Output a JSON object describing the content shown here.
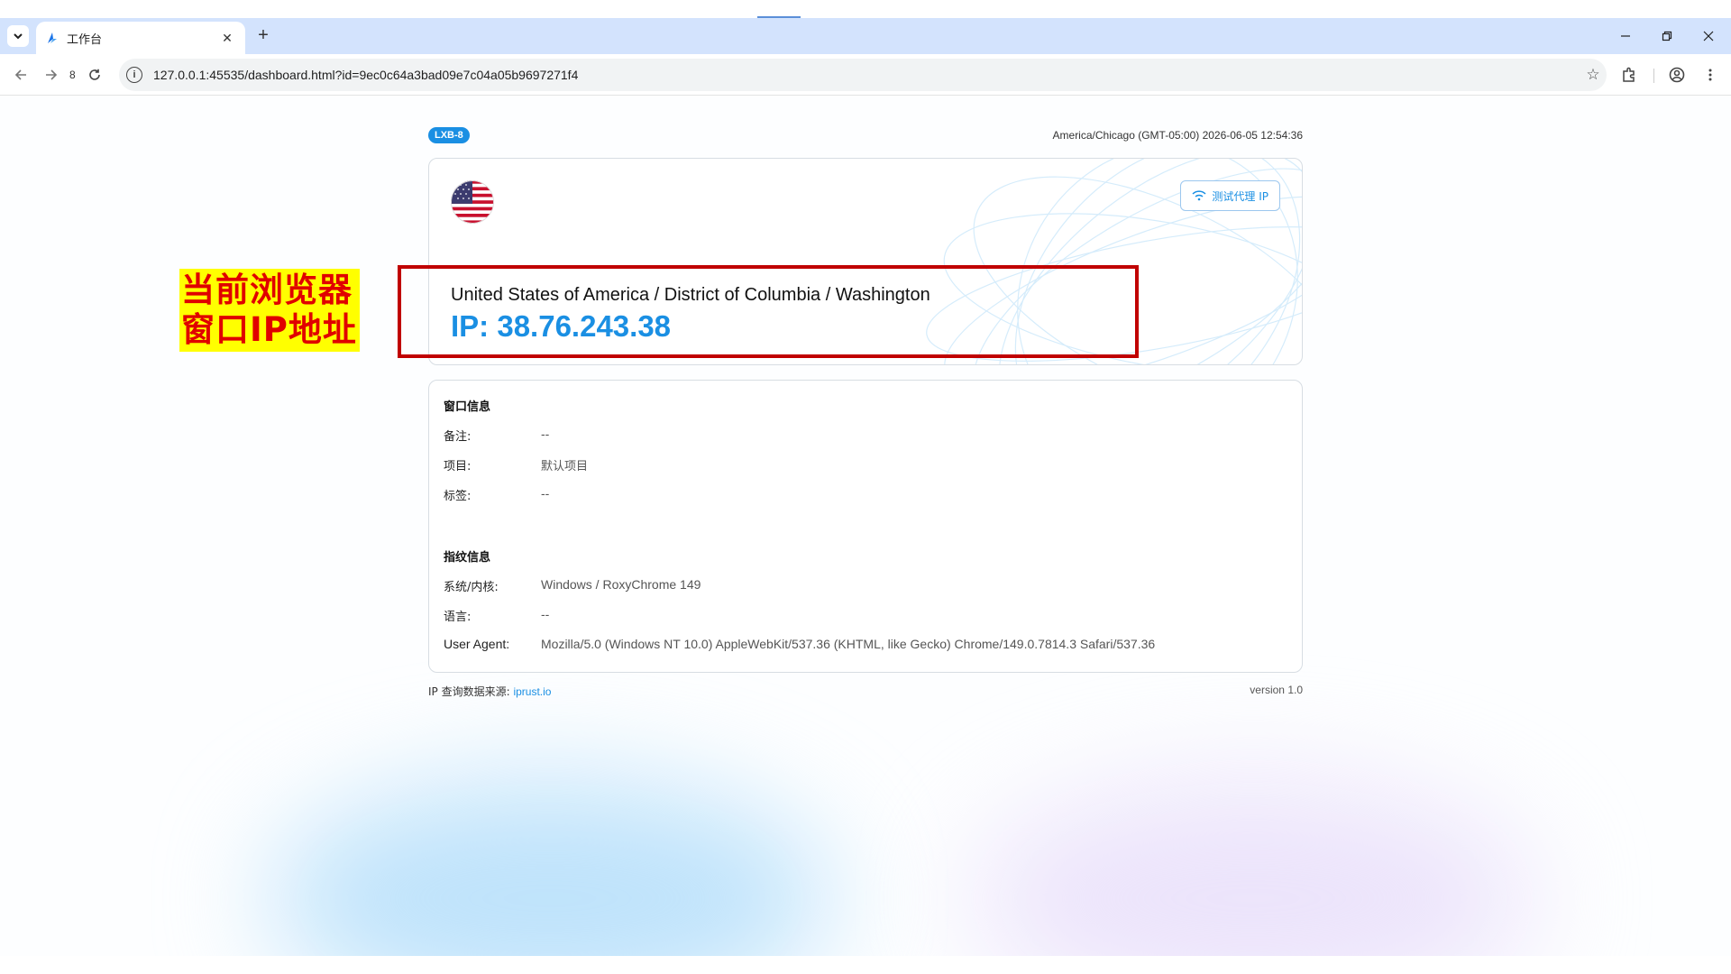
{
  "browser": {
    "tab": {
      "title": "工作台"
    },
    "nav": {
      "badge": "8"
    },
    "address_bar": {
      "url": "127.0.0.1:45535/dashboard.html?id=9ec0c64a3bad09e7c04a05b9697271f4"
    }
  },
  "header": {
    "badge": "LXB-8",
    "datetime": "America/Chicago (GMT-05:00) 2026-06-05 12:54:36"
  },
  "ip_card": {
    "flag_icon": "us-flag-icon",
    "test_button_label": "测试代理 IP",
    "location": "United States of America / District of Columbia / Washington",
    "ip": "IP: 38.76.243.38"
  },
  "annotation": {
    "line1": "当前浏览器",
    "line2": "窗口IP地址",
    "color": "#c00000",
    "highlight": "#ffff00"
  },
  "window_info": {
    "title": "窗口信息",
    "rows": [
      {
        "label": "备注:",
        "value": "--"
      },
      {
        "label": "项目:",
        "value": "默认项目"
      },
      {
        "label": "标签:",
        "value": "--"
      }
    ]
  },
  "fingerprint_info": {
    "title": "指纹信息",
    "rows": [
      {
        "label": "系统/内核:",
        "value": "Windows / RoxyChrome 149"
      },
      {
        "label": "语言:",
        "value": "--"
      },
      {
        "label": "User Agent:",
        "value": "Mozilla/5.0 (Windows NT 10.0) AppleWebKit/537.36 (KHTML, like Gecko) Chrome/149.0.7814.3 Safari/537.36"
      }
    ]
  },
  "footer": {
    "source_label": "IP 查询数据来源: ",
    "source_link": "iprust.io",
    "version": "version 1.0"
  },
  "colors": {
    "accent": "#1a8fe3",
    "tabbar": "#d3e3fd"
  }
}
